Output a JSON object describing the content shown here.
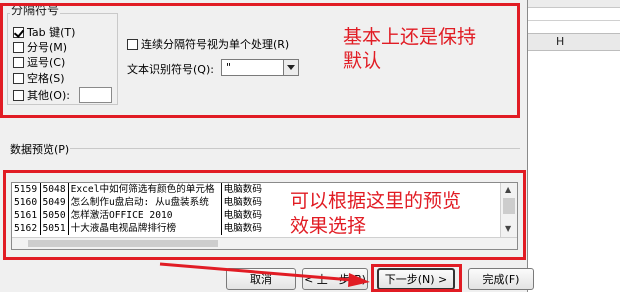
{
  "separators": {
    "legend": "分隔符号",
    "options": [
      {
        "label": "Tab 键(T)",
        "checked": true
      },
      {
        "label": "分号(M)",
        "checked": false
      },
      {
        "label": "逗号(C)",
        "checked": false
      },
      {
        "label": "空格(S)",
        "checked": false
      },
      {
        "label": "其他(O):",
        "checked": false
      }
    ],
    "other_value": ""
  },
  "consecutive": {
    "label": "连续分隔符号视为单个处理(R)",
    "checked": false
  },
  "text_qualifier": {
    "label": "文本识别符号(Q):",
    "value": "\""
  },
  "annotations": {
    "top_line1": "基本上还是保持",
    "top_line2": "默认",
    "preview_line1": "可以根据这里的预览",
    "preview_line2": "效果选择"
  },
  "preview": {
    "label": "数据预览(P)",
    "rows": [
      [
        "5159",
        "5048",
        "Excel中如何筛选有颜色的单元格",
        "电脑数码"
      ],
      [
        "5160",
        "5049",
        "怎么制作u盘启动: 从u盘装系统",
        "电脑数码"
      ],
      [
        "5161",
        "5050",
        "怎样激活OFFICE 2010",
        "电脑数码"
      ],
      [
        "5162",
        "5051",
        "十大液晶电视品牌排行榜",
        "电脑数码"
      ]
    ]
  },
  "buttons": {
    "cancel": "取消",
    "back": "< 上一步(B)",
    "next": "下一步(N) >",
    "finish": "完成(F)"
  },
  "excel": {
    "column_header": "H"
  },
  "colors": {
    "annotation": "#e11c24",
    "dialog_bg": "#f0f0f0"
  }
}
